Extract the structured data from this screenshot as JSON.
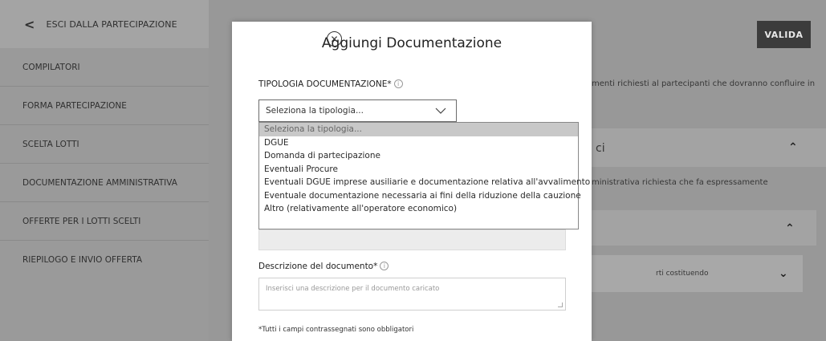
{
  "sidebar": {
    "back_label": "ESCI DALLA PARTECIPAZIONE",
    "items": [
      {
        "label": "COMPILATORI"
      },
      {
        "label": "FORMA PARTECIPAZIONE"
      },
      {
        "label": "SCELTA LOTTI"
      },
      {
        "label": "DOCUMENTAZIONE AMMINISTRATIVA"
      },
      {
        "label": "OFFERTE PER I LOTTI SCELTI"
      },
      {
        "label": "RIEPILOGO E INVIO OFFERTA"
      }
    ]
  },
  "header": {
    "valida_label": "VALIDA"
  },
  "background": {
    "text1": "menti richiesti al partecipanti che dovranno confluire in",
    "section_title": "ci",
    "text2": "ministrativa richiesta che fa espressamente",
    "row_label": "rti costituendo"
  },
  "modal": {
    "title": "Aggiungi Documentazione",
    "tipologia_label": "TIPOLOGIA DOCUMENTAZIONE*",
    "select_value": "Seleziona la tipologia...",
    "options": [
      "Seleziona la tipologia...",
      "DGUE",
      "Domanda di partecipazione",
      "Eventuali Procure",
      "Eventuali DGUE imprese ausiliarie e documentazione relativa all'avvalimento",
      "Eventuale documentazione necessaria ai fini della riduzione della cauzione",
      "Altro (relativamente all'operatore economico)"
    ],
    "descrizione_label": "Descrizione del documento*",
    "descrizione_placeholder": "Inserisci una descrizione per il documento caricato",
    "footnote": "*Tutti i campi contrassegnati sono obbligatori"
  }
}
